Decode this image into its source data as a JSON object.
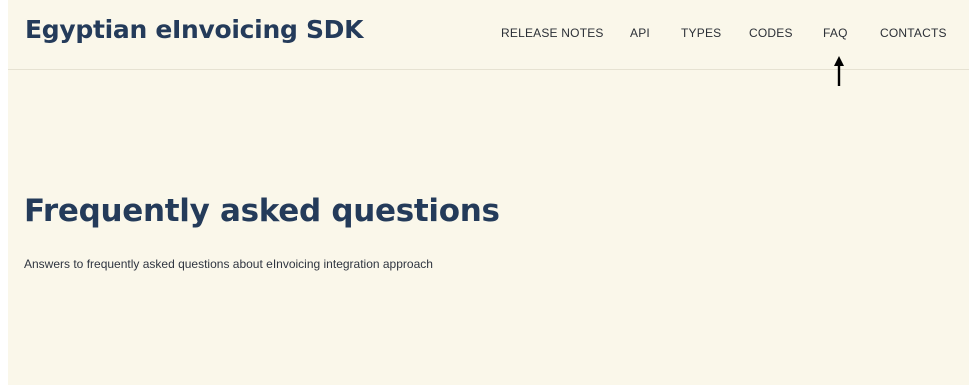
{
  "header": {
    "brand": "Egyptian eInvoicing SDK",
    "nav": [
      {
        "label": "RELEASE NOTES"
      },
      {
        "label": "API"
      },
      {
        "label": "TYPES"
      },
      {
        "label": "CODES"
      },
      {
        "label": "FAQ"
      },
      {
        "label": "CONTACTS"
      }
    ],
    "annotation_icon": "up-arrow-icon"
  },
  "main": {
    "title": "Frequently asked questions",
    "subtitle": "Answers to frequently asked questions about eInvoicing integration approach"
  },
  "colors": {
    "background": "#faf7ea",
    "heading": "#243b5a",
    "text": "#2b2f36"
  }
}
